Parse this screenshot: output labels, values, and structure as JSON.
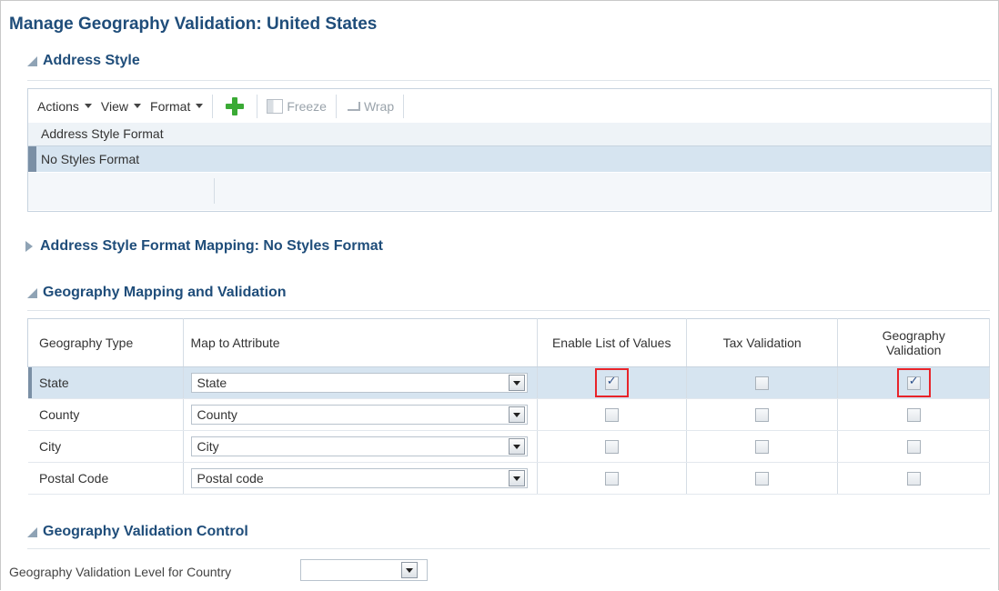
{
  "page_title": "Manage Geography Validation: United States",
  "address_style": {
    "heading": "Address Style",
    "toolbar": {
      "actions_label": "Actions",
      "view_label": "View",
      "format_label": "Format",
      "freeze_label": "Freeze",
      "wrap_label": "Wrap"
    },
    "column_header": "Address Style Format",
    "selected_row": "No Styles Format"
  },
  "format_mapping": {
    "heading": "Address Style Format Mapping: No Styles Format"
  },
  "geography_mapping": {
    "heading": "Geography Mapping and Validation",
    "columns": {
      "geo_type": "Geography Type",
      "map_attr": "Map to Attribute",
      "enable_lov": "Enable List of Values",
      "tax_validation": "Tax Validation",
      "geo_validation_line1": "Geography",
      "geo_validation_line2": "Validation"
    },
    "rows": [
      {
        "type": "State",
        "attribute": "State",
        "lov": true,
        "tax": false,
        "geo": true,
        "selected": true
      },
      {
        "type": "County",
        "attribute": "County",
        "lov": false,
        "tax": false,
        "geo": false,
        "selected": false
      },
      {
        "type": "City",
        "attribute": "City",
        "lov": false,
        "tax": false,
        "geo": false,
        "selected": false
      },
      {
        "type": "Postal Code",
        "attribute": "Postal code",
        "lov": false,
        "tax": false,
        "geo": false,
        "selected": false
      }
    ]
  },
  "validation_control": {
    "heading": "Geography Validation Control",
    "level_label": "Geography Validation Level for Country",
    "level_value": ""
  },
  "colors": {
    "heading": "#1f4d7a",
    "selected_row": "#d6e4f0",
    "highlight_box": "#e8242a",
    "add_icon": "#3aaa35"
  }
}
